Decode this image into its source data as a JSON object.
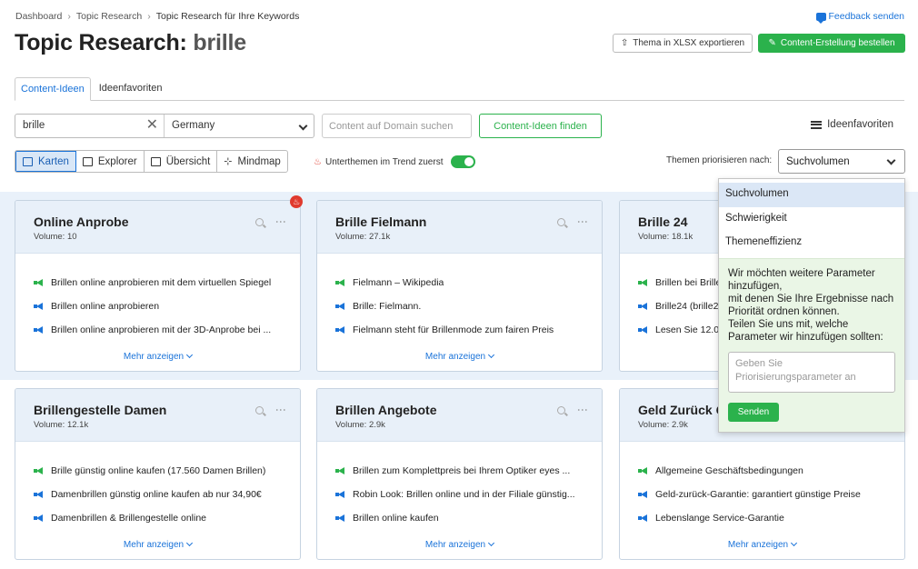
{
  "breadcrumb": [
    "Dashboard",
    "Topic Research",
    "Topic Research für Ihre Keywords"
  ],
  "feedback_label": "Feedback senden",
  "title": {
    "prefix": "Topic Research: ",
    "keyword": "brille"
  },
  "export_label": "Thema in XLSX exportieren",
  "order_label": "Content-Erstellung bestellen",
  "tabs": [
    "Content-Ideen",
    "Ideenfavoriten"
  ],
  "search": {
    "keyword": "brille",
    "country": "Germany",
    "domain_placeholder": "Content auf Domain suchen",
    "find_label": "Content-Ideen finden"
  },
  "favorites_link": "Ideenfavoriten",
  "views": [
    "Karten",
    "Explorer",
    "Übersicht",
    "Mindmap"
  ],
  "trend_label": "Unterthemen im Trend zuerst",
  "trend_on": true,
  "prio": {
    "label": "Themen priorisieren nach:",
    "selected": "Suchvolumen"
  },
  "dropdown": {
    "options": [
      "Suchvolumen",
      "Schwierigkeit",
      "Themeneffizienz"
    ],
    "feedback_text": "Wir möchten weitere Parameter hinzufügen,\nmit denen Sie Ihre Ergebnisse nach Priorität ordnen können.\nTeilen Sie uns mit, welche Parameter wir hinzufügen sollten:",
    "placeholder": "Geben Sie Priorisierungsparameter an",
    "send_label": "Senden"
  },
  "more_label": "Mehr anzeigen",
  "volume_prefix": "Volume: ",
  "colors": {
    "accent": "#1a73d9",
    "green": "#2bb24c",
    "hot": "#e03a2e"
  },
  "cards": [
    {
      "title": "Online Anprobe",
      "volume": "10",
      "hot": true,
      "items": [
        {
          "icon": "g",
          "text": "Brillen online anprobieren mit dem virtuellen Spiegel"
        },
        {
          "icon": "b",
          "text": "Brillen online anprobieren"
        },
        {
          "icon": "b",
          "text": "Brillen online anprobieren mit der 3D-Anprobe bei ..."
        }
      ]
    },
    {
      "title": "Brille Fielmann",
      "volume": "27.1k",
      "hot": false,
      "items": [
        {
          "icon": "g",
          "text": "Fielmann – Wikipedia"
        },
        {
          "icon": "b",
          "text": "Brille: Fielmann."
        },
        {
          "icon": "b",
          "text": "Fielmann steht für Brillenmode zum fairen Preis"
        }
      ]
    },
    {
      "title": "Brille 24",
      "volume": "18.1k",
      "hot": false,
      "items": [
        {
          "icon": "g",
          "text": "Brillen bei Brille24"
        },
        {
          "icon": "b",
          "text": "Brille24 (brille24.de)"
        },
        {
          "icon": "b",
          "text": "Lesen Sie 12.01"
        }
      ]
    },
    {
      "title": "Brillengestelle Damen",
      "volume": "12.1k",
      "hot": false,
      "items": [
        {
          "icon": "g",
          "text": "Brille günstig online kaufen (17.560 Damen Brillen)"
        },
        {
          "icon": "b",
          "text": "Damenbrillen günstig online kaufen ab nur 34,90€"
        },
        {
          "icon": "b",
          "text": "Damenbrillen & Brillengestelle online"
        }
      ]
    },
    {
      "title": "Brillen Angebote",
      "volume": "2.9k",
      "hot": false,
      "items": [
        {
          "icon": "g",
          "text": "Brillen zum Komplettpreis bei Ihrem Optiker eyes ..."
        },
        {
          "icon": "b",
          "text": "Robin Look: Brillen online und in der Filiale günstig..."
        },
        {
          "icon": "b",
          "text": "Brillen online kaufen"
        }
      ]
    },
    {
      "title": "Geld Zurück Garantie",
      "volume": "2.9k",
      "hot": false,
      "items": [
        {
          "icon": "g",
          "text": "Allgemeine Geschäftsbedingungen"
        },
        {
          "icon": "b",
          "text": "Geld-zurück-Garantie: garantiert günstige Preise"
        },
        {
          "icon": "b",
          "text": "Lebenslange Service-Garantie"
        }
      ]
    }
  ]
}
